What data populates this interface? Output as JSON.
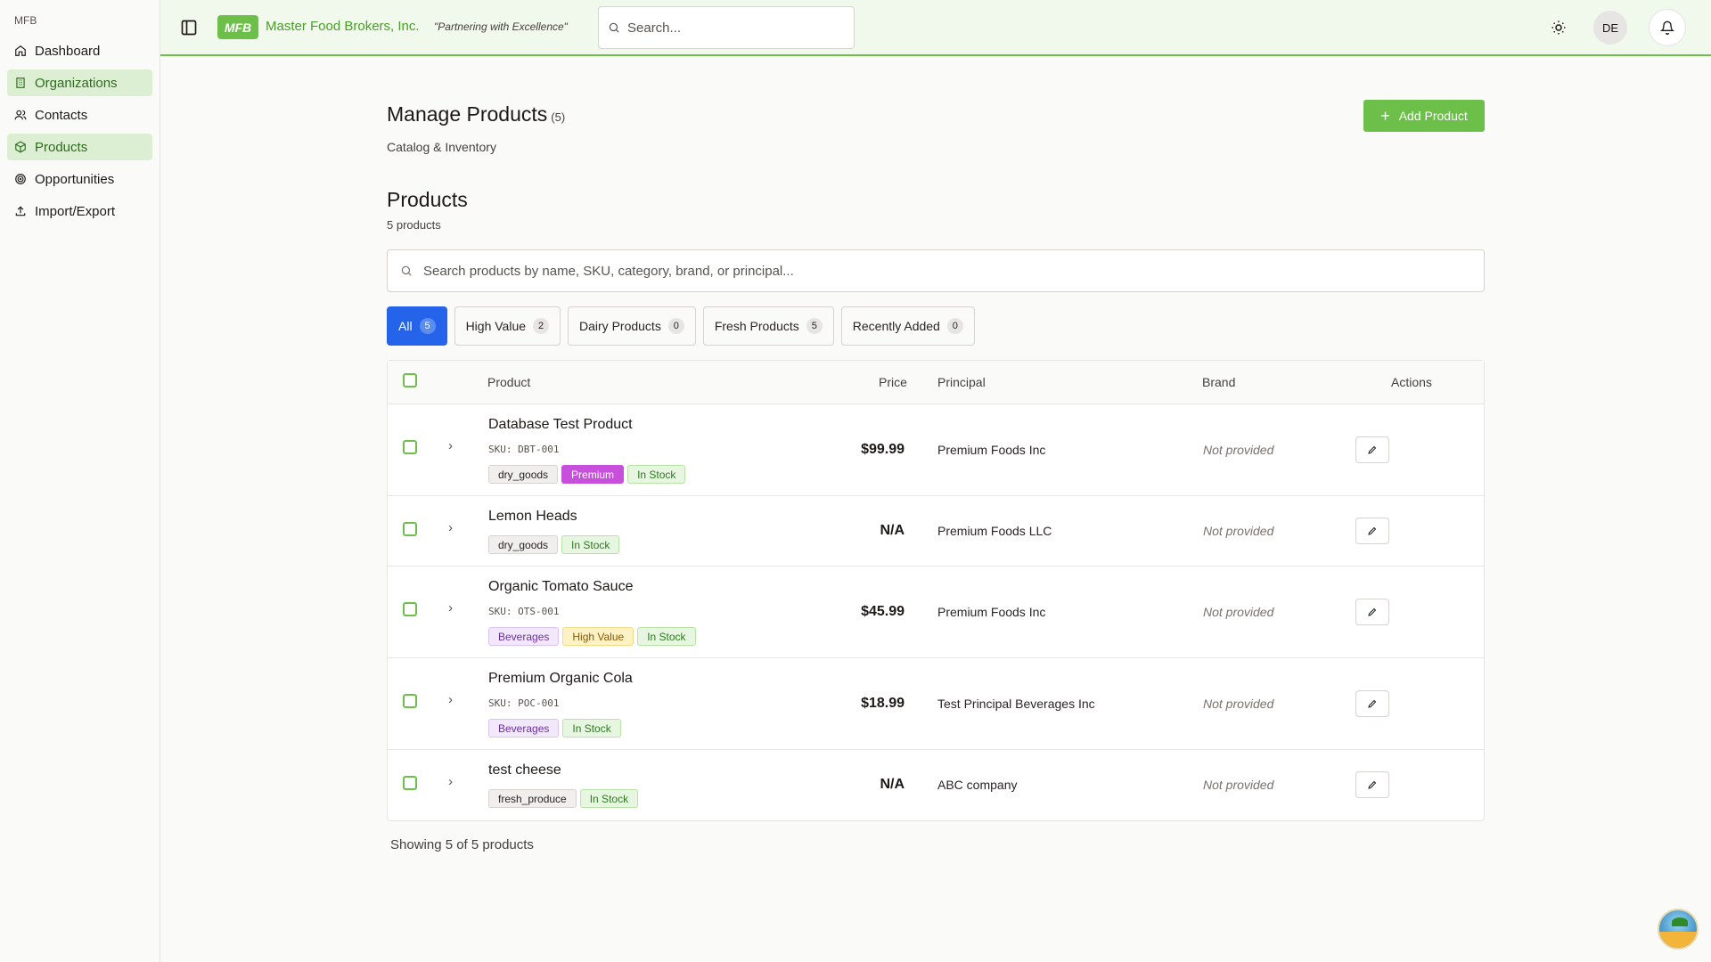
{
  "sidebar": {
    "brand": "MFB",
    "items": [
      {
        "label": "Dashboard",
        "icon": "home-icon",
        "active": false
      },
      {
        "label": "Organizations",
        "icon": "building-icon",
        "active": true
      },
      {
        "label": "Contacts",
        "icon": "users-icon",
        "active": false
      },
      {
        "label": "Products",
        "icon": "package-icon",
        "active": true
      },
      {
        "label": "Opportunities",
        "icon": "target-icon",
        "active": false
      },
      {
        "label": "Import/Export",
        "icon": "upload-icon",
        "active": false
      }
    ]
  },
  "header": {
    "logo": "MFB",
    "company": "Master Food Brokers, Inc.",
    "tagline": "\"Partnering with Excellence\"",
    "search_placeholder": "Search...",
    "avatar": "DE"
  },
  "page": {
    "title": "Manage Products",
    "count": "(5)",
    "subtitle": "Catalog & Inventory",
    "add_label": "Add Product",
    "section_title": "Products",
    "section_sub": "5 products",
    "search_placeholder": "Search products by name, SKU, category, brand, or principal...",
    "footer": "Showing 5 of 5 products"
  },
  "filters": [
    {
      "label": "All",
      "count": "5",
      "active": true
    },
    {
      "label": "High Value",
      "count": "2",
      "active": false
    },
    {
      "label": "Dairy Products",
      "count": "0",
      "active": false
    },
    {
      "label": "Fresh Products",
      "count": "5",
      "active": false
    },
    {
      "label": "Recently Added",
      "count": "0",
      "active": false
    }
  ],
  "table": {
    "headers": {
      "product": "Product",
      "price": "Price",
      "principal": "Principal",
      "brand": "Brand",
      "actions": "Actions"
    },
    "rows": [
      {
        "name": "Database Test Product",
        "sku": "SKU: DBT-001",
        "tags": [
          {
            "text": "dry_goods",
            "kind": "gray"
          },
          {
            "text": "Premium",
            "kind": "premium"
          },
          {
            "text": "In Stock",
            "kind": "stock"
          }
        ],
        "price": "$99.99",
        "principal": "Premium Foods Inc",
        "brand": "Not provided"
      },
      {
        "name": "Lemon Heads",
        "sku": "",
        "tags": [
          {
            "text": "dry_goods",
            "kind": "gray"
          },
          {
            "text": "In Stock",
            "kind": "stock"
          }
        ],
        "price": "N/A",
        "principal": "Premium Foods LLC",
        "brand": "Not provided"
      },
      {
        "name": "Organic Tomato Sauce",
        "sku": "SKU: OTS-001",
        "tags": [
          {
            "text": "Beverages",
            "kind": "beverage"
          },
          {
            "text": "High Value",
            "kind": "highval"
          },
          {
            "text": "In Stock",
            "kind": "stock"
          }
        ],
        "price": "$45.99",
        "principal": "Premium Foods Inc",
        "brand": "Not provided"
      },
      {
        "name": "Premium Organic Cola",
        "sku": "SKU: POC-001",
        "tags": [
          {
            "text": "Beverages",
            "kind": "beverage"
          },
          {
            "text": "In Stock",
            "kind": "stock"
          }
        ],
        "price": "$18.99",
        "principal": "Test Principal Beverages Inc",
        "brand": "Not provided"
      },
      {
        "name": "test cheese",
        "sku": "",
        "tags": [
          {
            "text": "fresh_produce",
            "kind": "gray"
          },
          {
            "text": "In Stock",
            "kind": "stock"
          }
        ],
        "price": "N/A",
        "principal": "ABC company",
        "brand": "Not provided"
      }
    ]
  },
  "colors": {
    "accent": "#6cc04a",
    "active_filter": "#2563eb"
  }
}
